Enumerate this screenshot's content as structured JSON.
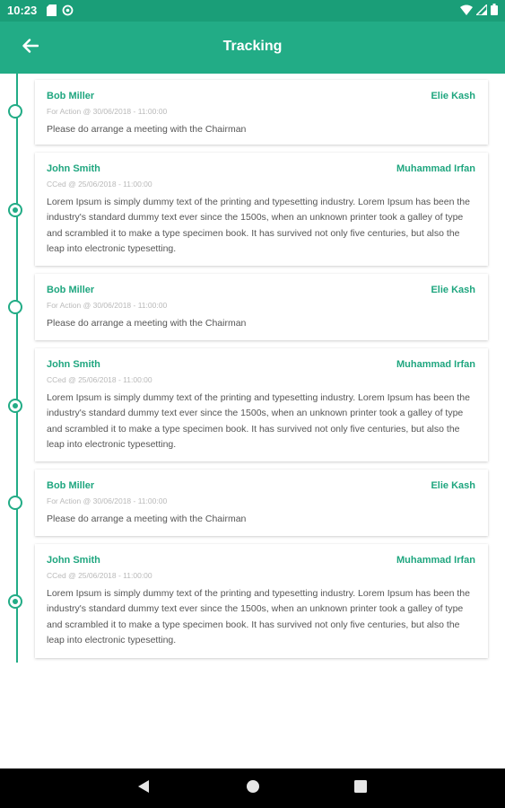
{
  "status_bar": {
    "time": "10:23"
  },
  "app_bar": {
    "title": "Tracking"
  },
  "entries": [
    {
      "from": "Bob Miller",
      "to": "Elie Kash",
      "meta": "For Action @ 30/06/2018 - 11:00:00",
      "body": "Please do arrange a meeting with the Chairman",
      "node": "hollow"
    },
    {
      "from": "John Smith",
      "to": "Muhammad Irfan",
      "meta": "CCed @ 25/06/2018 - 11:00:00",
      "body": "Lorem Ipsum is simply dummy text of the printing and typesetting industry. Lorem Ipsum has been the industry's standard dummy text ever since the 1500s, when an unknown printer took a galley of type and scrambled it to make a type specimen book. It has survived not only five centuries, but also the leap into electronic typesetting.",
      "node": "filled"
    },
    {
      "from": "Bob Miller",
      "to": "Elie Kash",
      "meta": "For Action @ 30/06/2018 - 11:00:00",
      "body": "Please do arrange a meeting with the Chairman",
      "node": "hollow"
    },
    {
      "from": "John Smith",
      "to": "Muhammad Irfan",
      "meta": "CCed @ 25/06/2018 - 11:00:00",
      "body": "Lorem Ipsum is simply dummy text of the printing and typesetting industry. Lorem Ipsum has been the industry's standard dummy text ever since the 1500s, when an unknown printer took a galley of type and scrambled it to make a type specimen book. It has survived not only five centuries, but also the leap into electronic typesetting.",
      "node": "filled"
    },
    {
      "from": "Bob Miller",
      "to": "Elie Kash",
      "meta": "For Action @ 30/06/2018 - 11:00:00",
      "body": "Please do arrange a meeting with the Chairman",
      "node": "hollow"
    },
    {
      "from": "John Smith",
      "to": "Muhammad Irfan",
      "meta": "CCed @ 25/06/2018 - 11:00:00",
      "body": "Lorem Ipsum is simply dummy text of the printing and typesetting industry. Lorem Ipsum has been the industry's standard dummy text ever since the 1500s, when an unknown printer took a galley of type and scrambled it to make a type specimen book. It has survived not only five centuries, but also the leap into electronic typesetting.",
      "node": "filled"
    }
  ],
  "icons": {
    "back": "arrow-left-icon",
    "status_left": [
      "sd-card-icon",
      "sync-icon"
    ],
    "status_right": [
      "wifi-icon",
      "signal-icon",
      "battery-icon"
    ],
    "nav": [
      "nav-back-icon",
      "nav-home-icon",
      "nav-recents-icon"
    ]
  },
  "colors": {
    "status_bar": "#1a9e78",
    "app_bar": "#22ac86",
    "accent": "#1fa67f",
    "nav_bar": "#000000"
  }
}
